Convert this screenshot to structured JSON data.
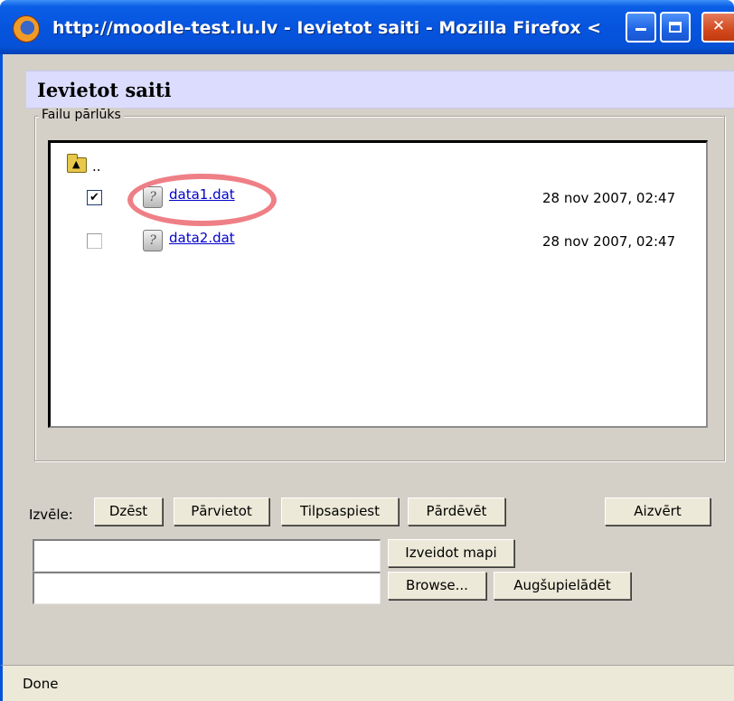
{
  "window": {
    "title": "http://moodle-test.lu.lv - Ievietot saiti - Mozilla Firefox <"
  },
  "page": {
    "heading": "Ievietot saiti"
  },
  "file_browser": {
    "legend": "Failu pārlūks",
    "parent_label": "..",
    "files": [
      {
        "name": "data1.dat",
        "date": "28 nov 2007, 02:47",
        "checked": true
      },
      {
        "name": "data2.dat",
        "date": "28 nov 2007, 02:47",
        "checked": false
      }
    ],
    "highlight_color": "#ef7f86"
  },
  "actions": {
    "select_label": "Izvēle:",
    "delete_label": "Dzēst",
    "move_label": "Pārvietot",
    "zip_label": "Tilpsaspiest",
    "rename_label": "Pārdēvēt",
    "close_label": "Aizvērt"
  },
  "folder_form": {
    "name_value": "",
    "create_label": "Izveidot mapi"
  },
  "upload_form": {
    "file_value": "",
    "browse_label": "Browse...",
    "upload_label": "Augšupielādēt"
  },
  "status": {
    "text": "Done"
  },
  "colors": {
    "titlebar": "#0653dd",
    "heading_band": "#dcdcff",
    "window_bg": "#d4d0c8",
    "link": "#0000cc"
  }
}
